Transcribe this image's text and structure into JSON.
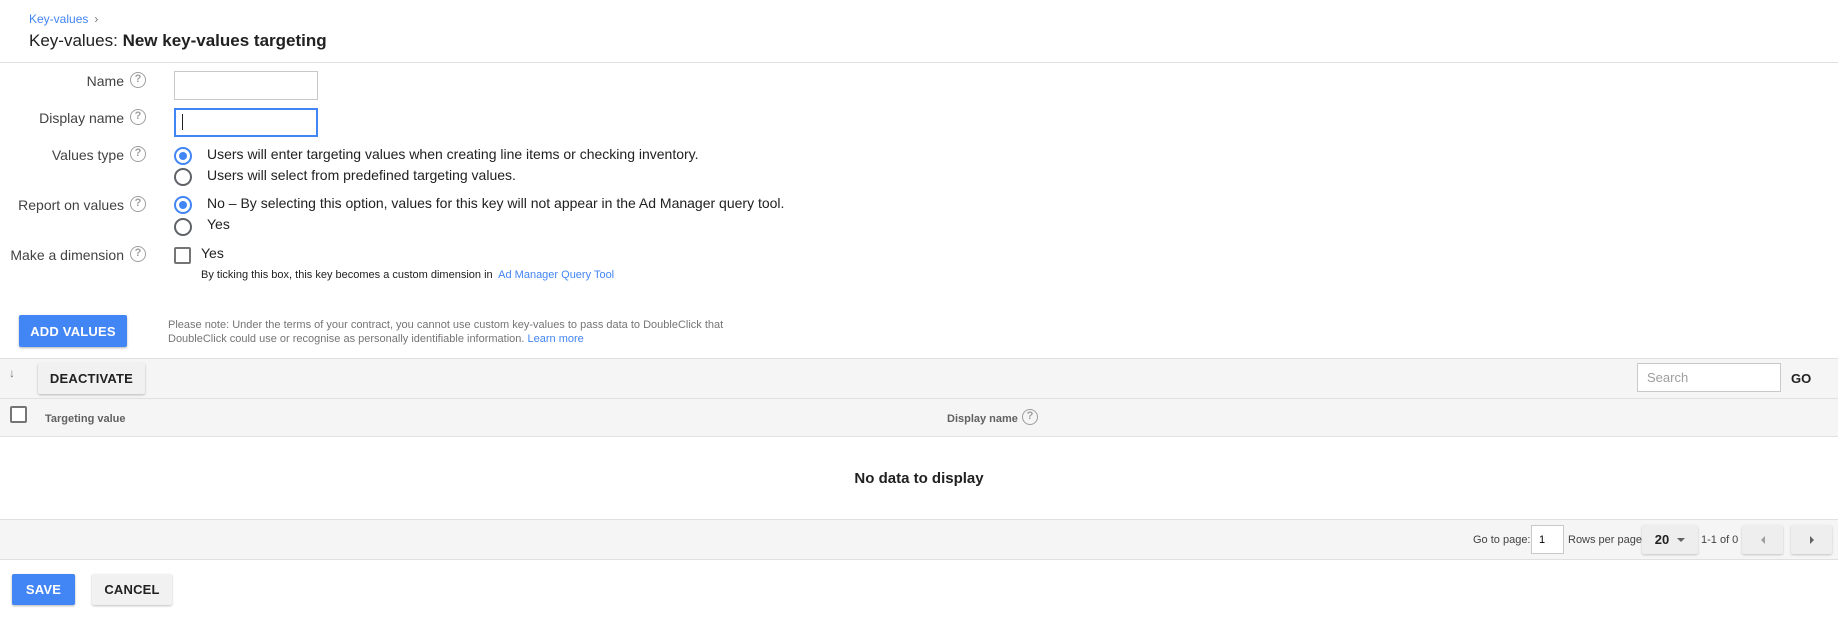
{
  "breadcrumb": {
    "parent": "Key-values",
    "separator": "›"
  },
  "page": {
    "title_prefix": "Key-values:",
    "title_main": "New key-values targeting"
  },
  "form": {
    "name": {
      "label": "Name",
      "value": ""
    },
    "display_name": {
      "label": "Display name",
      "value": ""
    },
    "values_type": {
      "label": "Values type",
      "options": [
        {
          "label": "Users will enter targeting values when creating line items or checking inventory.",
          "selected": true
        },
        {
          "label": "Users will select from predefined targeting values.",
          "selected": false
        }
      ]
    },
    "report_on_values": {
      "label": "Report on values",
      "options": [
        {
          "label": "No – By selecting this option, values for this key will not appear in the Ad Manager query tool.",
          "selected": true
        },
        {
          "label": "Yes",
          "selected": false
        }
      ]
    },
    "make_dimension": {
      "label": "Make a dimension",
      "checkbox_label": "Yes",
      "checked": false,
      "hint": "By ticking this box, this key becomes a custom dimension in",
      "hint_link": "Ad Manager Query Tool"
    },
    "help_icon": "question-circle-icon"
  },
  "add_values_button": "ADD VALUES",
  "note": {
    "text": "Please note: Under the terms of your contract, you cannot use custom key-values to pass data to DoubleClick that DoubleClick could use or recognise as personally identifiable information.",
    "link": "Learn more"
  },
  "table": {
    "toolbar": {
      "sort_icon": "arrow-down-icon",
      "deactivate_label": "DEACTIVATE",
      "search_placeholder": "Search",
      "go_label": "GO"
    },
    "columns": [
      "Targeting value",
      "Display name"
    ],
    "empty_message": "No data to display",
    "pager": {
      "go_to_page_label": "Go to page:",
      "page_value": "1",
      "rows_per_page_label": "Rows per page",
      "rows_per_page_value": "20",
      "range_text": "1-1 of 0"
    }
  },
  "footer": {
    "save_label": "SAVE",
    "cancel_label": "CANCEL"
  },
  "colors": {
    "accent": "#4285f4",
    "toolbar_bg": "#f5f5f5",
    "border": "#e0e0e0"
  }
}
